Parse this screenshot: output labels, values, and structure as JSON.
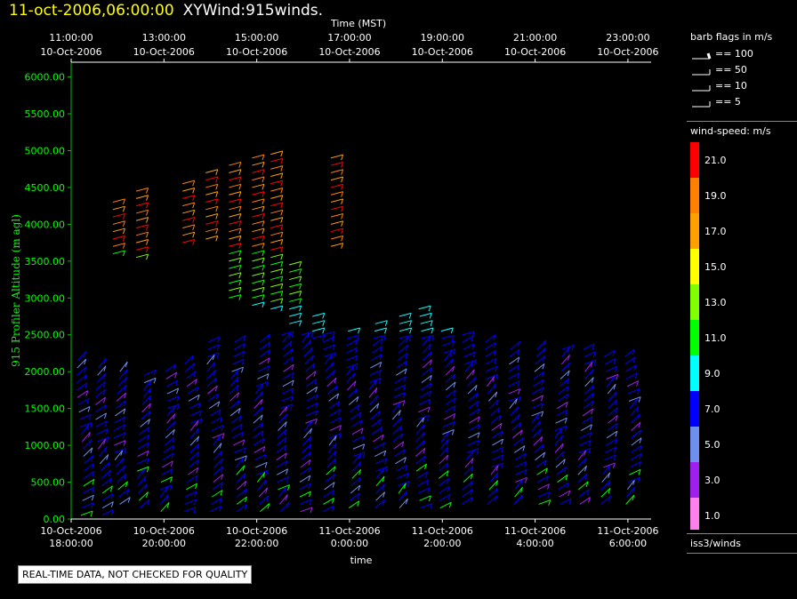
{
  "header": {
    "date": "11-oct-2006,06:00:00",
    "title": "XYWind:915winds."
  },
  "notice": "REAL-TIME DATA, NOT CHECKED FOR QUALITY",
  "legend": {
    "barb_title": "barb flags in m/s",
    "barbs": [
      "== 100",
      "== 50",
      "== 10",
      "== 5"
    ],
    "speed_title": "wind-speed: m/s",
    "scale": [
      {
        "label": "21.0",
        "color": "#ff0000"
      },
      {
        "label": "19.0",
        "color": "#ff7f00"
      },
      {
        "label": "17.0",
        "color": "#ff9f00"
      },
      {
        "label": "15.0",
        "color": "#ffff00"
      },
      {
        "label": "13.0",
        "color": "#7fff00"
      },
      {
        "label": "11.0",
        "color": "#00ff00"
      },
      {
        "label": "9.0",
        "color": "#00ffff"
      },
      {
        "label": "7.0",
        "color": "#0000ff"
      },
      {
        "label": "5.0",
        "color": "#6f8fef"
      },
      {
        "label": "3.0",
        "color": "#9f1fef"
      },
      {
        "label": "1.0",
        "color": "#ff7fef"
      }
    ],
    "source": "iss3/winds"
  },
  "chart_data": {
    "type": "scatter",
    "title": "",
    "top_axis_title": "Time (MST)",
    "xlabel": "time",
    "ylabel": "915 Profiler Altitude (m agl)",
    "ylim": [
      0,
      6200
    ],
    "yticks": [
      "0.00",
      "500.00",
      "1000.00",
      "1500.00",
      "2000.00",
      "2500.00",
      "3000.00",
      "3500.00",
      "4000.00",
      "4500.00",
      "5000.00",
      "5500.00",
      "6000.00"
    ],
    "bottom_ticks": [
      {
        "date": "10-Oct-2006",
        "time": "18:00:00"
      },
      {
        "date": "10-Oct-2006",
        "time": "20:00:00"
      },
      {
        "date": "10-Oct-2006",
        "time": "22:00:00"
      },
      {
        "date": "11-Oct-2006",
        "time": "0:00:00"
      },
      {
        "date": "11-Oct-2006",
        "time": "2:00:00"
      },
      {
        "date": "11-Oct-2006",
        "time": "4:00:00"
      },
      {
        "date": "11-Oct-2006",
        "time": "6:00:00"
      }
    ],
    "top_ticks": [
      {
        "time": "11:00:00",
        "date": "10-Oct-2006"
      },
      {
        "time": "13:00:00",
        "date": "10-Oct-2006"
      },
      {
        "time": "15:00:00",
        "date": "10-Oct-2006"
      },
      {
        "time": "17:00:00",
        "date": "10-Oct-2006"
      },
      {
        "time": "19:00:00",
        "date": "10-Oct-2006"
      },
      {
        "time": "21:00:00",
        "date": "10-Oct-2006"
      },
      {
        "time": "23:00:00",
        "date": "10-Oct-2006"
      }
    ],
    "x_range_hours": [
      18,
      30.5
    ],
    "profiles": [
      {
        "t": 18.2,
        "top": 2150,
        "bottom": 50
      },
      {
        "t": 18.6,
        "top": 2050,
        "bottom": 50
      },
      {
        "t": 19.0,
        "top": 2000,
        "bottom": 200
      },
      {
        "t": 19.5,
        "top": 2000,
        "bottom": 150
      },
      {
        "t": 20.0,
        "top": 2050,
        "bottom": 100
      },
      {
        "t": 20.5,
        "top": 2100,
        "bottom": 100
      },
      {
        "t": 21.0,
        "top": 2450,
        "bottom": 100
      },
      {
        "t": 21.5,
        "top": 2450,
        "bottom": 100
      },
      {
        "t": 22.0,
        "top": 2450,
        "bottom": 100
      },
      {
        "t": 22.5,
        "top": 2550,
        "bottom": 100
      },
      {
        "t": 23.0,
        "top": 2550,
        "bottom": 100
      },
      {
        "t": 23.5,
        "top": 2550,
        "bottom": 100
      },
      {
        "t": 24.0,
        "top": 2600,
        "bottom": 150
      },
      {
        "t": 24.5,
        "top": 2700,
        "bottom": 150
      },
      {
        "t": 25.0,
        "top": 2800,
        "bottom": 150
      },
      {
        "t": 25.5,
        "top": 2850,
        "bottom": 150
      },
      {
        "t": 26.0,
        "top": 2550,
        "bottom": 150
      },
      {
        "t": 26.5,
        "top": 2500,
        "bottom": 200
      },
      {
        "t": 27.0,
        "top": 2400,
        "bottom": 200
      },
      {
        "t": 27.5,
        "top": 2300,
        "bottom": 200
      },
      {
        "t": 28.0,
        "top": 2300,
        "bottom": 200
      },
      {
        "t": 28.5,
        "top": 2300,
        "bottom": 200
      },
      {
        "t": 29.0,
        "top": 2300,
        "bottom": 200
      },
      {
        "t": 29.5,
        "top": 2250,
        "bottom": 200
      },
      {
        "t": 30.0,
        "top": 2250,
        "bottom": 200
      }
    ],
    "upper_profiles": [
      {
        "t": 18.9,
        "top": 4300,
        "bottom": 3600
      },
      {
        "t": 19.4,
        "top": 4500,
        "bottom": 3550
      },
      {
        "t": 20.4,
        "top": 4600,
        "bottom": 3750
      },
      {
        "t": 20.9,
        "top": 4700,
        "bottom": 3800
      },
      {
        "t": 21.4,
        "top": 4800,
        "bottom": 3000
      },
      {
        "t": 21.9,
        "top": 4900,
        "bottom": 2900
      },
      {
        "t": 22.3,
        "top": 4950,
        "bottom": 2850
      },
      {
        "t": 22.7,
        "top": 3450,
        "bottom": 2650
      },
      {
        "t": 23.2,
        "top": 2750,
        "bottom": 2450
      },
      {
        "t": 23.6,
        "top": 4950,
        "bottom": 3700
      }
    ]
  }
}
